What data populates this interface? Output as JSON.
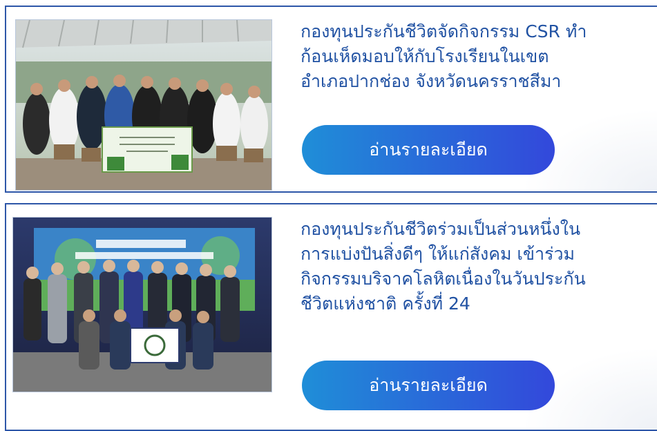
{
  "news": [
    {
      "title_lines": [
        "กองทุนประกันชีวิตจัดกิจกรรม CSR ทำ",
        "ก้อนเห็ดมอบให้กับโรงเรียนในเขต",
        "อำเภอปากช่อง จังหวัดนครราชสีมา"
      ],
      "button_label": "อ่านรายละเอียด"
    },
    {
      "title_lines": [
        "กองทุนประกันชีวิตร่วมเป็นส่วนหนึ่งใน",
        "การแบ่งปันสิ่งดีๆ ให้แก่สังคม เข้าร่วม",
        "กิจกรรมบริจาคโลหิตเนื่องในวันประกัน",
        "ชีวิตแห่งชาติ ครั้งที่ 24"
      ],
      "button_label": "อ่านรายละเอียด"
    }
  ],
  "colors": {
    "border": "#2d56a8",
    "title": "#2152a3",
    "button_start": "#1f8ed8",
    "button_end": "#3348db"
  }
}
